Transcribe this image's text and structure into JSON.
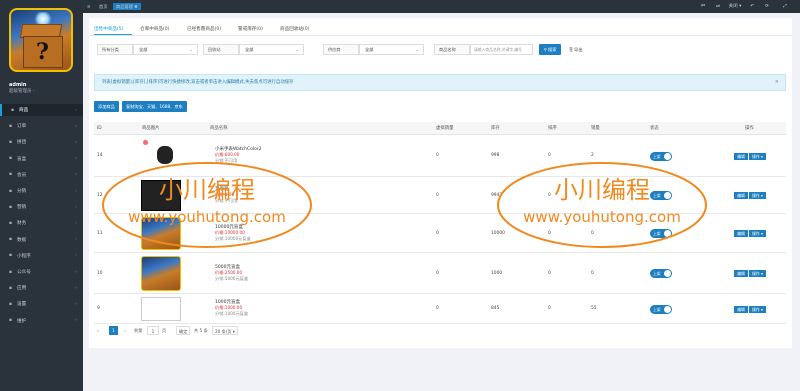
{
  "sidebar": {
    "user_name": "admin",
    "user_role": "超级管理员 -",
    "items": [
      {
        "label": "商品",
        "icon": "cube-icon",
        "active": true
      },
      {
        "label": "订单",
        "icon": "order-icon"
      },
      {
        "label": "拼团",
        "icon": "group-icon"
      },
      {
        "label": "盲盒",
        "icon": "box-icon"
      },
      {
        "label": "会员",
        "icon": "user-icon"
      },
      {
        "label": "分销",
        "icon": "share-icon"
      },
      {
        "label": "营销",
        "icon": "marketing-icon"
      },
      {
        "label": "财务",
        "icon": "finance-icon"
      },
      {
        "label": "数据",
        "icon": "data-icon"
      },
      {
        "label": "小程序",
        "icon": "miniapp-icon"
      },
      {
        "label": "公众号",
        "icon": "wechat-icon"
      },
      {
        "label": "应用",
        "icon": "apps-icon"
      },
      {
        "label": "设置",
        "icon": "settings-icon"
      },
      {
        "label": "维护",
        "icon": "maintain-icon"
      }
    ]
  },
  "topbar": {
    "home": "首页",
    "goods_tab": "商品管理 ✖",
    "menu": "≡",
    "right_buttons": [
      "⏮",
      "⏭",
      "关闭 ▾",
      "↶",
      "⟳",
      "⤢"
    ]
  },
  "tabs": [
    "出售中商品(5)",
    "仓库中商品(0)",
    "已经售罄商品(0)",
    "警戒库存(0)",
    "商品回收站(0)"
  ],
  "filters": {
    "category_label": "所有分类",
    "category_value": "全部",
    "group_label": "回收站",
    "group_value": "全部",
    "supplier_label": "供应商",
    "supplier_value": "全部",
    "name_label": "商品名称",
    "search_placeholder": "请输入商品名称,关键字,编号",
    "search_button": "搜索",
    "export_button": "导出"
  },
  "alert": "列表[虚拟销量],[库存],[排序]可进行快捷修改,双击或者单击进入编辑模式,失去焦点可进行自动保存",
  "actions": {
    "add_goods": "添加商品",
    "copy_goods": "复制淘宝、天猫、1688、京东"
  },
  "table": {
    "headers": [
      "ID",
      "商品图片",
      "商品名称",
      "虚拟销量",
      "库存",
      "排序",
      "销量",
      "状态",
      "操作"
    ],
    "rows": [
      {
        "id": "14",
        "name": "小米手表WatchColor2",
        "price": "价格:600.00",
        "share": "分销:不可用",
        "virtual_sales": "0",
        "stock": "998",
        "sort": "0",
        "sales": "2",
        "status": "上架",
        "edit": "编辑",
        "more": "操作 ▾"
      },
      {
        "id": "12",
        "name": "显示器",
        "price": "价格:1.00",
        "share": "分销:不可用",
        "virtual_sales": "0",
        "stock": "9947",
        "sort": "0",
        "sales": "",
        "status": "上架",
        "edit": "编辑",
        "more": "操作 ▾"
      },
      {
        "id": "11",
        "name": "10000元盲盒",
        "price": "价格:10000.00",
        "share": "分销:10000元盲盒",
        "virtual_sales": "0",
        "stock": "10000",
        "sort": "0",
        "sales": "0",
        "status": "上架",
        "edit": "编辑",
        "more": "操作 ▾"
      },
      {
        "id": "10",
        "name": "5000元盲盒",
        "price": "价格:2500.00",
        "share": "分销:5000元盲盒",
        "virtual_sales": "0",
        "stock": "1000",
        "sort": "0",
        "sales": "0",
        "status": "上架",
        "edit": "编辑",
        "more": "操作 ▾"
      },
      {
        "id": "9",
        "name": "1000元盲盒",
        "price": "价格:1000.00",
        "share": "分销:1000元盲盒",
        "virtual_sales": "0",
        "stock": "845",
        "sort": "0",
        "sales": "55",
        "status": "上架",
        "edit": "编辑",
        "more": "操作 ▾"
      }
    ]
  },
  "pager": {
    "prev": "‹",
    "current": "1",
    "next": "›",
    "goto": "到第",
    "page_input": "1",
    "page_unit": "页",
    "confirm": "确定",
    "total": "共 5 条",
    "per_page": "20 条/页 ▾"
  },
  "watermark": {
    "title": "小川编程",
    "url": "www.youhutong.com"
  },
  "colors": {
    "sidebar_bg": "#2a323c",
    "primary": "#1d7fc1",
    "alert_bg": "#e0f3fb",
    "watermark": "#f08a20"
  }
}
